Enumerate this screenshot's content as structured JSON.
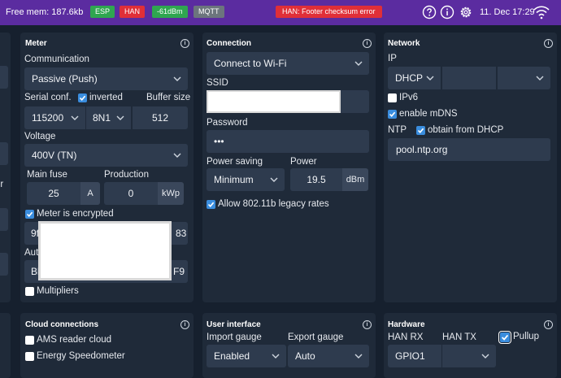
{
  "topbar": {
    "free_mem": "Free mem: 187.6kb",
    "badges": [
      "ESP",
      "HAN",
      "-61dBm",
      "MQTT"
    ],
    "error": "HAN: Footer checksum error",
    "time": "11. Dec 17:29",
    "icons": [
      "help-icon",
      "info-icon",
      "gear-icon",
      "wifi-icon"
    ],
    "colors": {
      "bar": "#5b2ca0",
      "ok": "#2fa650",
      "error": "#e02f38",
      "neutral": "#6c757d"
    }
  },
  "left_edge": {
    "fragment": "er"
  },
  "meter": {
    "title": "Meter",
    "communication_label": "Communication",
    "communication_value": "Passive (Push)",
    "serial_conf_label": "Serial conf.",
    "inverted_label": "inverted",
    "buffer_size_label": "Buffer size",
    "baud": "115200",
    "parity": "8N1",
    "buffer_size": "512",
    "voltage_label": "Voltage",
    "voltage_value": "400V (TN)",
    "main_fuse_label": "Main fuse",
    "main_fuse_value": "25",
    "main_fuse_unit": "A",
    "production_label": "Production",
    "production_value": "0",
    "production_unit": "kWp",
    "encrypted_label": "Meter is encrypted",
    "enc_key_start": "9f",
    "enc_key_end": "83",
    "auth_label_start": "Aut",
    "auth_key_start": "Bl",
    "auth_key_end": "F9",
    "multipliers_label": "Multipliers"
  },
  "connection": {
    "title": "Connection",
    "mode": "Connect to Wi-Fi",
    "ssid_label": "SSID",
    "password_label": "Password",
    "password_value": "•••",
    "power_saving_label": "Power saving",
    "power_saving_value": "Minimum",
    "power_label": "Power",
    "power_value": "19.5",
    "power_unit": "dBm",
    "legacy_label": "Allow 802.11b legacy rates"
  },
  "network": {
    "title": "Network",
    "ip_label": "IP",
    "ip_mode": "DHCP",
    "ipv6_label": "IPv6",
    "mdns_label": "enable mDNS",
    "ntp_label": "NTP",
    "ntp_dhcp_label": "obtain from DHCP",
    "ntp_server": "pool.ntp.org"
  },
  "cloud": {
    "title": "Cloud connections",
    "ams_label": "AMS reader cloud",
    "energy_label": "Energy Speedometer"
  },
  "ui": {
    "title": "User interface",
    "import_label": "Import gauge",
    "export_label": "Export gauge",
    "import_value": "Enabled",
    "export_value": "Auto"
  },
  "hardware": {
    "title": "Hardware",
    "han_rx_label": "HAN RX",
    "han_tx_label": "HAN TX",
    "pullup_label": "Pullup",
    "han_rx_value": "GPIO1"
  }
}
